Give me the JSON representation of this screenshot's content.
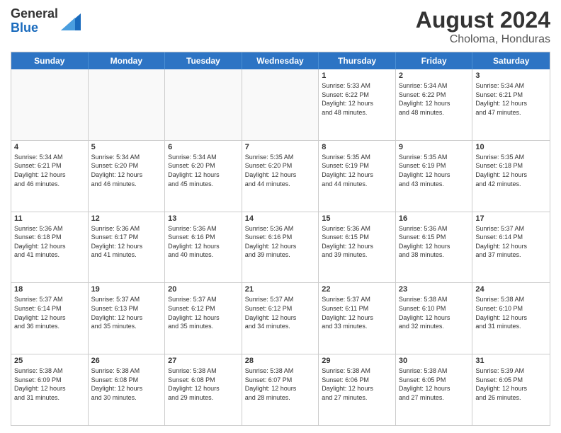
{
  "header": {
    "logo_general": "General",
    "logo_blue": "Blue",
    "month_year": "August 2024",
    "location": "Choloma, Honduras"
  },
  "days_of_week": [
    "Sunday",
    "Monday",
    "Tuesday",
    "Wednesday",
    "Thursday",
    "Friday",
    "Saturday"
  ],
  "rows": [
    [
      {
        "day": "",
        "info": ""
      },
      {
        "day": "",
        "info": ""
      },
      {
        "day": "",
        "info": ""
      },
      {
        "day": "",
        "info": ""
      },
      {
        "day": "1",
        "info": "Sunrise: 5:33 AM\nSunset: 6:22 PM\nDaylight: 12 hours\nand 48 minutes."
      },
      {
        "day": "2",
        "info": "Sunrise: 5:34 AM\nSunset: 6:22 PM\nDaylight: 12 hours\nand 48 minutes."
      },
      {
        "day": "3",
        "info": "Sunrise: 5:34 AM\nSunset: 6:21 PM\nDaylight: 12 hours\nand 47 minutes."
      }
    ],
    [
      {
        "day": "4",
        "info": "Sunrise: 5:34 AM\nSunset: 6:21 PM\nDaylight: 12 hours\nand 46 minutes."
      },
      {
        "day": "5",
        "info": "Sunrise: 5:34 AM\nSunset: 6:20 PM\nDaylight: 12 hours\nand 46 minutes."
      },
      {
        "day": "6",
        "info": "Sunrise: 5:34 AM\nSunset: 6:20 PM\nDaylight: 12 hours\nand 45 minutes."
      },
      {
        "day": "7",
        "info": "Sunrise: 5:35 AM\nSunset: 6:20 PM\nDaylight: 12 hours\nand 44 minutes."
      },
      {
        "day": "8",
        "info": "Sunrise: 5:35 AM\nSunset: 6:19 PM\nDaylight: 12 hours\nand 44 minutes."
      },
      {
        "day": "9",
        "info": "Sunrise: 5:35 AM\nSunset: 6:19 PM\nDaylight: 12 hours\nand 43 minutes."
      },
      {
        "day": "10",
        "info": "Sunrise: 5:35 AM\nSunset: 6:18 PM\nDaylight: 12 hours\nand 42 minutes."
      }
    ],
    [
      {
        "day": "11",
        "info": "Sunrise: 5:36 AM\nSunset: 6:18 PM\nDaylight: 12 hours\nand 41 minutes."
      },
      {
        "day": "12",
        "info": "Sunrise: 5:36 AM\nSunset: 6:17 PM\nDaylight: 12 hours\nand 41 minutes."
      },
      {
        "day": "13",
        "info": "Sunrise: 5:36 AM\nSunset: 6:16 PM\nDaylight: 12 hours\nand 40 minutes."
      },
      {
        "day": "14",
        "info": "Sunrise: 5:36 AM\nSunset: 6:16 PM\nDaylight: 12 hours\nand 39 minutes."
      },
      {
        "day": "15",
        "info": "Sunrise: 5:36 AM\nSunset: 6:15 PM\nDaylight: 12 hours\nand 39 minutes."
      },
      {
        "day": "16",
        "info": "Sunrise: 5:36 AM\nSunset: 6:15 PM\nDaylight: 12 hours\nand 38 minutes."
      },
      {
        "day": "17",
        "info": "Sunrise: 5:37 AM\nSunset: 6:14 PM\nDaylight: 12 hours\nand 37 minutes."
      }
    ],
    [
      {
        "day": "18",
        "info": "Sunrise: 5:37 AM\nSunset: 6:14 PM\nDaylight: 12 hours\nand 36 minutes."
      },
      {
        "day": "19",
        "info": "Sunrise: 5:37 AM\nSunset: 6:13 PM\nDaylight: 12 hours\nand 35 minutes."
      },
      {
        "day": "20",
        "info": "Sunrise: 5:37 AM\nSunset: 6:12 PM\nDaylight: 12 hours\nand 35 minutes."
      },
      {
        "day": "21",
        "info": "Sunrise: 5:37 AM\nSunset: 6:12 PM\nDaylight: 12 hours\nand 34 minutes."
      },
      {
        "day": "22",
        "info": "Sunrise: 5:37 AM\nSunset: 6:11 PM\nDaylight: 12 hours\nand 33 minutes."
      },
      {
        "day": "23",
        "info": "Sunrise: 5:38 AM\nSunset: 6:10 PM\nDaylight: 12 hours\nand 32 minutes."
      },
      {
        "day": "24",
        "info": "Sunrise: 5:38 AM\nSunset: 6:10 PM\nDaylight: 12 hours\nand 31 minutes."
      }
    ],
    [
      {
        "day": "25",
        "info": "Sunrise: 5:38 AM\nSunset: 6:09 PM\nDaylight: 12 hours\nand 31 minutes."
      },
      {
        "day": "26",
        "info": "Sunrise: 5:38 AM\nSunset: 6:08 PM\nDaylight: 12 hours\nand 30 minutes."
      },
      {
        "day": "27",
        "info": "Sunrise: 5:38 AM\nSunset: 6:08 PM\nDaylight: 12 hours\nand 29 minutes."
      },
      {
        "day": "28",
        "info": "Sunrise: 5:38 AM\nSunset: 6:07 PM\nDaylight: 12 hours\nand 28 minutes."
      },
      {
        "day": "29",
        "info": "Sunrise: 5:38 AM\nSunset: 6:06 PM\nDaylight: 12 hours\nand 27 minutes."
      },
      {
        "day": "30",
        "info": "Sunrise: 5:38 AM\nSunset: 6:05 PM\nDaylight: 12 hours\nand 27 minutes."
      },
      {
        "day": "31",
        "info": "Sunrise: 5:39 AM\nSunset: 6:05 PM\nDaylight: 12 hours\nand 26 minutes."
      }
    ]
  ]
}
